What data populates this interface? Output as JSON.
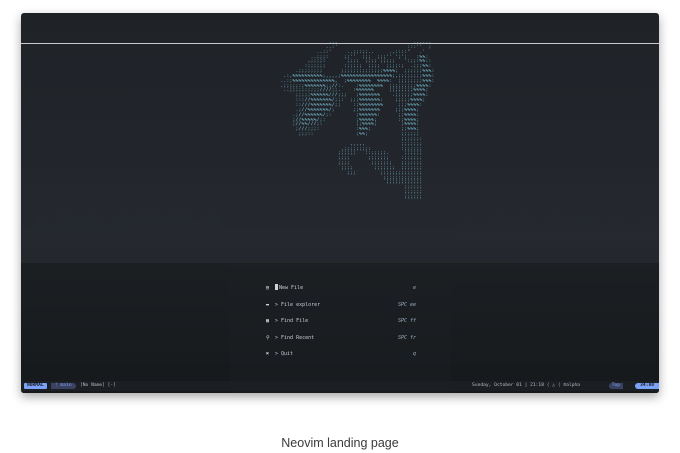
{
  "caption": "Neovim landing page",
  "dashboard": {
    "items": [
      {
        "icon": "file-icon",
        "label": "New File",
        "key": "e"
      },
      {
        "icon": "folder-icon",
        "label": "> File explorer",
        "key": "SPC ee"
      },
      {
        "icon": "find-file-icon",
        "label": "> Find File",
        "key": "SPC ff"
      },
      {
        "icon": "search-icon",
        "label": "> Find Recent",
        "key": "SPC fr"
      },
      {
        "icon": "quit-icon",
        "label": "> Quit",
        "key": "q"
      }
    ]
  },
  "statusline": {
    "mode": "NORMAL",
    "branch": "main",
    "filename": "[No Name] [-]",
    "datetime": "Sunday, October 01 | 21:18",
    "filetype": "alpha",
    "position": "Top",
    "time": "34:80"
  },
  "colors": {
    "accent": "#7aa2f7",
    "art": "#7ac3d6",
    "background": "#22262c"
  }
}
